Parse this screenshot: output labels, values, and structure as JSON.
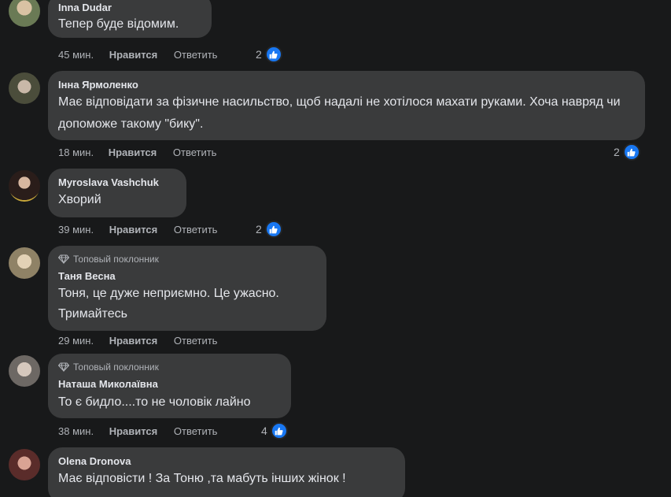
{
  "comments": [
    {
      "author": "Inna Dudar",
      "fan_badge": "",
      "text": "Тепер буде відомим.",
      "time": "45 мин.",
      "like_label": "Нравится",
      "reply_label": "Ответить",
      "reaction_count": "2",
      "reaction_icon": "like-icon",
      "avatar_color": "#7a6a4f"
    },
    {
      "author": "Інна Ярмоленко",
      "fan_badge": "",
      "text": "Має відповідати за фізичне насильство, щоб надалі не хотілося махати руками. Хоча навряд чи допоможе такому \"бику\".",
      "time": "18 мин.",
      "like_label": "Нравится",
      "reply_label": "Ответить",
      "reaction_count": "2",
      "reaction_icon": "like-icon",
      "avatar_color": "#8a8f7a"
    },
    {
      "author": "Myroslava Vashchuk",
      "fan_badge": "",
      "text": "Хворий",
      "time": "39 мин.",
      "like_label": "Нравится",
      "reply_label": "Ответить",
      "reaction_count": "2",
      "reaction_icon": "like-icon",
      "avatar_color": "#3d2a25"
    },
    {
      "author": "Таня Весна",
      "fan_badge": "Топовый поклонник",
      "text": "Тоня, це дуже неприємно. Це ужасно. Тримайтесь",
      "time": "29 мин.",
      "like_label": "Нравится",
      "reply_label": "Ответить",
      "reaction_count": "",
      "reaction_icon": "",
      "avatar_color": "#b9ab8e"
    },
    {
      "author": "Наташа Миколаївна",
      "fan_badge": "Топовый поклонник",
      "text": "То є бидло....то не чоловік лайно",
      "time": "38 мин.",
      "like_label": "Нравится",
      "reply_label": "Ответить",
      "reaction_count": "4",
      "reaction_icon": "like-icon",
      "avatar_color": "#9a8f88"
    },
    {
      "author": "Olena Dronova",
      "fan_badge": "",
      "text": "Має відповісти ! За Тоню ,та мабуть інших жінок !",
      "time": "",
      "like_label": "",
      "reply_label": "",
      "reaction_count": "",
      "reaction_icon": "",
      "avatar_color": "#6b3a36"
    }
  ]
}
